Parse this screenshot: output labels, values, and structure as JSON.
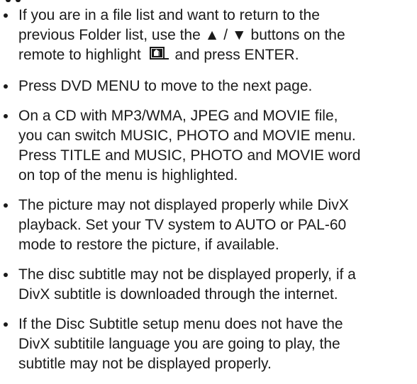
{
  "notes": [
    {
      "lines": [
        "If you are in a file list and want to return to the",
        "previous Folder list, use the ▲ / ▼ buttons on the"
      ],
      "line3_before": "remote to highlight",
      "line3_icon": "folder-up-icon",
      "line3_after": "and press ENTER."
    },
    {
      "lines": [
        "Press DVD MENU to move to the next page."
      ]
    },
    {
      "lines": [
        "On a CD with MP3/WMA, JPEG and MOVIE file,",
        "you can switch MUSIC, PHOTO and MOVIE menu.",
        "Press TITLE and MUSIC, PHOTO and MOVIE word",
        "on top of the menu is highlighted."
      ]
    },
    {
      "lines": [
        "The picture may not displayed properly while DivX",
        "playback. Set your TV system to AUTO or PAL-60",
        "mode to restore the picture, if available."
      ]
    },
    {
      "lines": [
        "The disc subtitle may not be displayed properly, if a",
        "DivX subtitle is downloaded through the internet."
      ]
    },
    {
      "lines": [
        "If the Disc Subtitle setup menu does not have the",
        "DivX subtitile language you are going to play, the",
        "subtitle may not be displayed properly."
      ]
    }
  ]
}
